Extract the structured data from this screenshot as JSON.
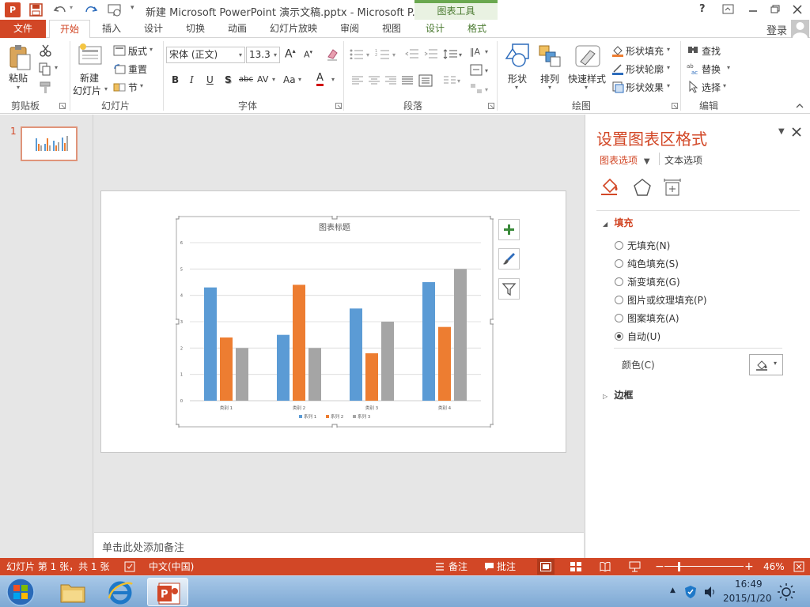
{
  "titlebar": {
    "title": "新建 Microsoft PowerPoint 演示文稿.pptx - Microsoft P...",
    "contextual_group": "图表工具",
    "help": "?",
    "login": "登录"
  },
  "tabs": [
    "文件",
    "开始",
    "插入",
    "设计",
    "切换",
    "动画",
    "幻灯片放映",
    "审阅",
    "视图",
    "设计",
    "格式"
  ],
  "ribbon": {
    "clipboard": {
      "paste": "粘贴",
      "label": "剪贴板"
    },
    "slides": {
      "new_slide_1": "新建",
      "new_slide_2": "幻灯片",
      "layout": "版式",
      "reset": "重置",
      "section": "节",
      "label": "幻灯片"
    },
    "font": {
      "font_name": "宋体 (正文)",
      "font_size": "13.3",
      "bold": "B",
      "italic": "I",
      "underline": "U",
      "shadow": "S",
      "strike": "abc",
      "spacing": "AV",
      "case": "Aa",
      "color": "A",
      "label": "字体"
    },
    "paragraph": {
      "label": "段落"
    },
    "drawing": {
      "shape": "形状",
      "arrange": "排列",
      "quick_styles": "快速样式",
      "shape_fill": "形状填充",
      "shape_outline": "形状轮廓",
      "shape_effects": "形状效果",
      "label": "绘图"
    },
    "editing": {
      "find": "查找",
      "replace": "替换",
      "select": "选择",
      "label": "编辑"
    }
  },
  "thumbnails": [
    {
      "number": "1"
    }
  ],
  "notes_placeholder": "单击此处添加备注",
  "chart_data": {
    "type": "bar",
    "title": "图表标题",
    "categories": [
      "类别 1",
      "类别 2",
      "类别 3",
      "类别 4"
    ],
    "series": [
      {
        "name": "系列 1",
        "values": [
          4.3,
          2.5,
          3.5,
          4.5
        ],
        "color": "#5b9bd5"
      },
      {
        "name": "系列 2",
        "values": [
          2.4,
          4.4,
          1.8,
          2.8
        ],
        "color": "#ed7d31"
      },
      {
        "name": "系列 3",
        "values": [
          2,
          2,
          3,
          5
        ],
        "color": "#a5a5a5"
      }
    ],
    "yticks": [
      "0",
      "1",
      "2",
      "3",
      "4",
      "5",
      "6"
    ],
    "ylim": [
      0,
      6
    ],
    "grid": true,
    "legend": "bottom"
  },
  "format_pane": {
    "title": "设置图表区格式",
    "tab_chart_options": "图表选项",
    "tab_text_options": "文本选项",
    "fill_header": "填充",
    "options": [
      "无填充(N)",
      "纯色填充(S)",
      "渐变填充(G)",
      "图片或纹理填充(P)",
      "图案填充(A)",
      "自动(U)"
    ],
    "selected_index": 5,
    "color_label": "颜色(C)",
    "border_header": "边框"
  },
  "statusbar": {
    "slide_info": "幻灯片 第 1 张，共 1 张",
    "language": "中文(中国)",
    "notes": "备注",
    "comments": "批注",
    "zoom": "46%",
    "zoom_level": 0.46
  },
  "taskbar": {
    "time": "16:49",
    "date": "2015/1/20"
  },
  "colors": {
    "accent": "#d24726",
    "workspace": "#e6e6e6"
  }
}
